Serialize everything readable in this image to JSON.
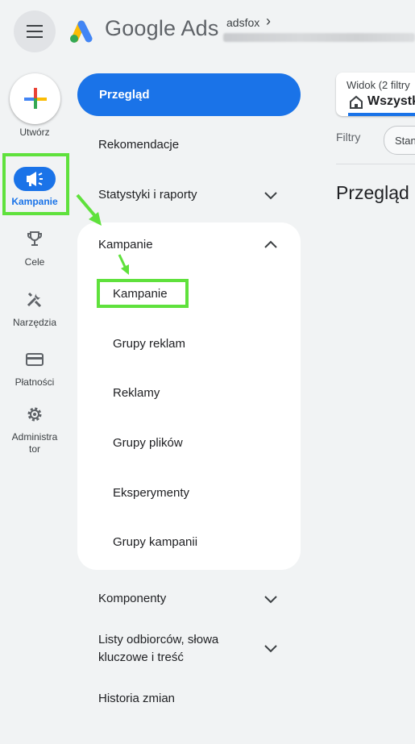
{
  "header": {
    "brand": "Google Ads",
    "account_name": "adsfox",
    "account_chevron": "›"
  },
  "rail": {
    "create_label": "Utwórz",
    "items": [
      {
        "label": "Kampanie",
        "icon": "megaphone-icon",
        "active": true
      },
      {
        "label": "Cele",
        "icon": "trophy-icon"
      },
      {
        "label": "Narzędzia",
        "icon": "tools-icon"
      },
      {
        "label": "Płatności",
        "icon": "credit-card-icon"
      },
      {
        "label": "Administra",
        "label2": "tor",
        "icon": "gear-icon"
      }
    ]
  },
  "nav": {
    "overview": "Przegląd",
    "recommendations": "Rekomendacje",
    "stats": "Statystyki i raporty",
    "campaigns_group": "Kampanie",
    "campaigns_sub": [
      "Kampanie",
      "Grupy reklam",
      "Reklamy",
      "Grupy plików",
      "Eksperymenty",
      "Grupy kampanii"
    ],
    "components": "Komponenty",
    "audiences_line1": "Listy odbiorców, słowa",
    "audiences_line2": "kluczowe i treść",
    "history": "Historia zmian"
  },
  "main": {
    "view_label": "Widok (2 filtry",
    "view_value": "Wszystk",
    "filters_label": "Filtry",
    "filter_chip": "Stan",
    "page_title": "Przegląd"
  },
  "colors": {
    "accent": "#1a73e8",
    "highlight": "#5fe13c",
    "background": "#f1f3f4"
  }
}
